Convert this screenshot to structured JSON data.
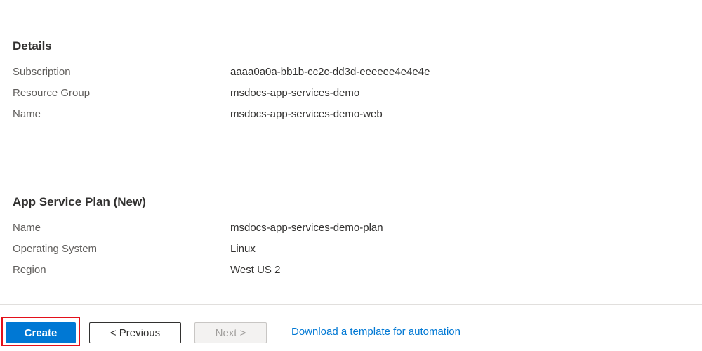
{
  "details": {
    "title": "Details",
    "rows": [
      {
        "label": "Subscription",
        "value": "aaaa0a0a-bb1b-cc2c-dd3d-eeeeee4e4e4e"
      },
      {
        "label": "Resource Group",
        "value": "msdocs-app-services-demo"
      },
      {
        "label": "Name",
        "value": "msdocs-app-services-demo-web"
      }
    ]
  },
  "plan": {
    "title": "App Service Plan (New)",
    "rows": [
      {
        "label": "Name",
        "value": "msdocs-app-services-demo-plan"
      },
      {
        "label": "Operating System",
        "value": "Linux"
      },
      {
        "label": "Region",
        "value": "West US 2"
      }
    ]
  },
  "footer": {
    "create_label": "Create",
    "previous_label": "< Previous",
    "next_label": "Next >",
    "download_link": "Download a template for automation"
  },
  "colors": {
    "accent": "#0078d4",
    "highlight": "#e3101a"
  }
}
